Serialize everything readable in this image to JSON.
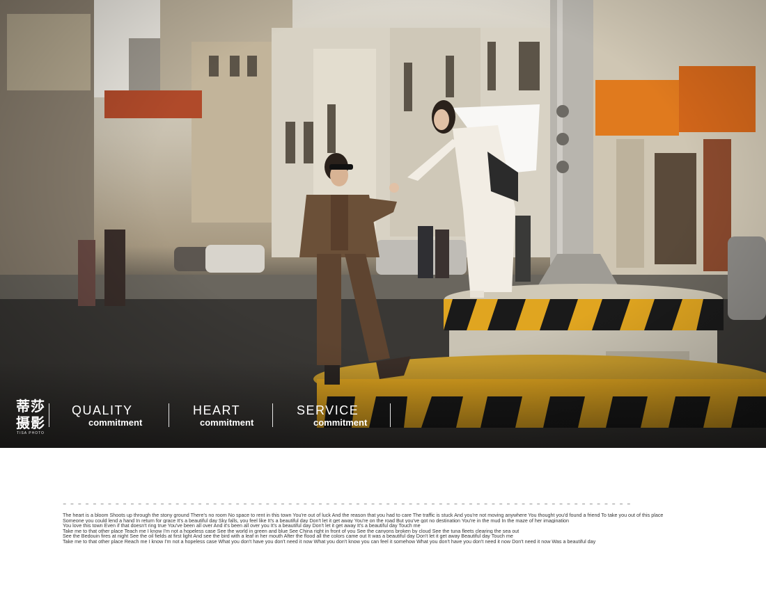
{
  "branding": {
    "logo_cn": "蒂莎摄影",
    "logo_en": "TISA PHOTO"
  },
  "slogans": [
    {
      "title": "QUALITY",
      "sub": "commitment"
    },
    {
      "title": "HEART",
      "sub": "commitment"
    },
    {
      "title": "SERVICE",
      "sub": "commitment"
    }
  ],
  "photo": {
    "description_icon": "street-wedding-photo",
    "accent_colors": {
      "pillar_yellow": "#e0a520",
      "pillar_black": "#1a1a1a",
      "suit_brown": "#6b5038",
      "dress_white": "#f2ede4"
    }
  },
  "text_block": {
    "divider": "– – – – – – – – – – – – – – – – – – – – – – – – – – – – – – – – – – – – – – – – – – – – – – – – – – – – – – – – – – – – – – – – – – – – – – – – – – – – – – – – – – – – – – – – – – – – – – – – – – – –",
    "lines": [
      "The heart is a bloom Shoots up through the stony ground There's no room No space to rent in this town You're out of luck And the reason that you had to care The traffic is stuck And you're not moving anywhere  You thought you'd found a friend To take you out of this place",
      "Someone you could lend a hand In return for grace It's a beautiful day  Sky falls, you feel like It's a beautiful day Don't let it get away  You're on the road But you've got no destination  You're in the mud In the maze of her imagination",
      "You love this town Even if that doesn't ring true  You've been all over And it's been all over you It's a beautiful day  Don't let it get away It's a beautiful day Touch me",
      "Take me to that other place Teach me I know I'm not a hopeless case  See the world in green and blue See  China right in front of you  See the canyons broken by cloud See the tuna fleets clearing the sea out",
      "See the Bedouin fires at night See the oil fields at first light And see the bird with a leaf in her mouth After the  flood all the colors came out It was a beautiful day Don't let it get away Beautiful day Touch me",
      "Take me to that other place  Reach me I know I'm not a hopeless case  What you don't have you don't need it now What you don't know you can feel it somehow  What you don't have you don't need it now Don't need it now Was a beautiful day"
    ]
  }
}
